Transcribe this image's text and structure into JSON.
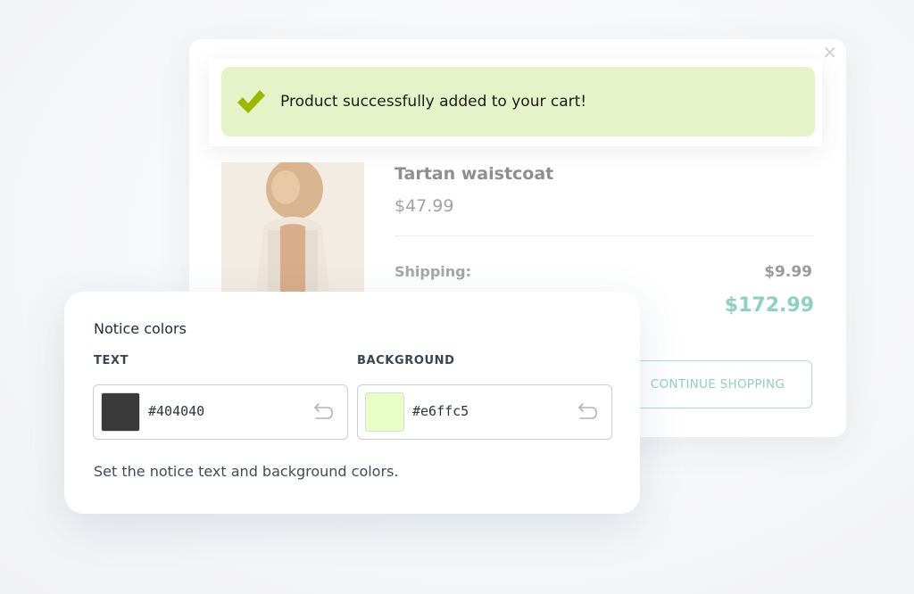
{
  "popup": {
    "close_symbol": "×",
    "notice": {
      "text": "Product successfully added to your cart!",
      "icon": "checkmark-icon",
      "background": "#e6f2c8",
      "check_color": "#9ab800"
    },
    "product": {
      "name": "Tartan waistcoat",
      "price": "$47.99"
    },
    "shipping": {
      "label": "Shipping:",
      "value": "$9.99"
    },
    "total": {
      "value": "$172.99"
    },
    "continue_button": "CONTINUE SHOPPING"
  },
  "settings": {
    "title": "Notice colors",
    "text_color": {
      "label": "TEXT",
      "value": "#404040",
      "reset_icon": "undo-icon"
    },
    "background_color": {
      "label": "BACKGROUND",
      "value": "#e6ffc5",
      "reset_icon": "undo-icon"
    },
    "help": "Set the notice text and background colors."
  },
  "colors": {
    "accent_teal": "#8fd0c4",
    "text_swatch": "#3a3a3a",
    "background_swatch": "#e6ffc5"
  }
}
